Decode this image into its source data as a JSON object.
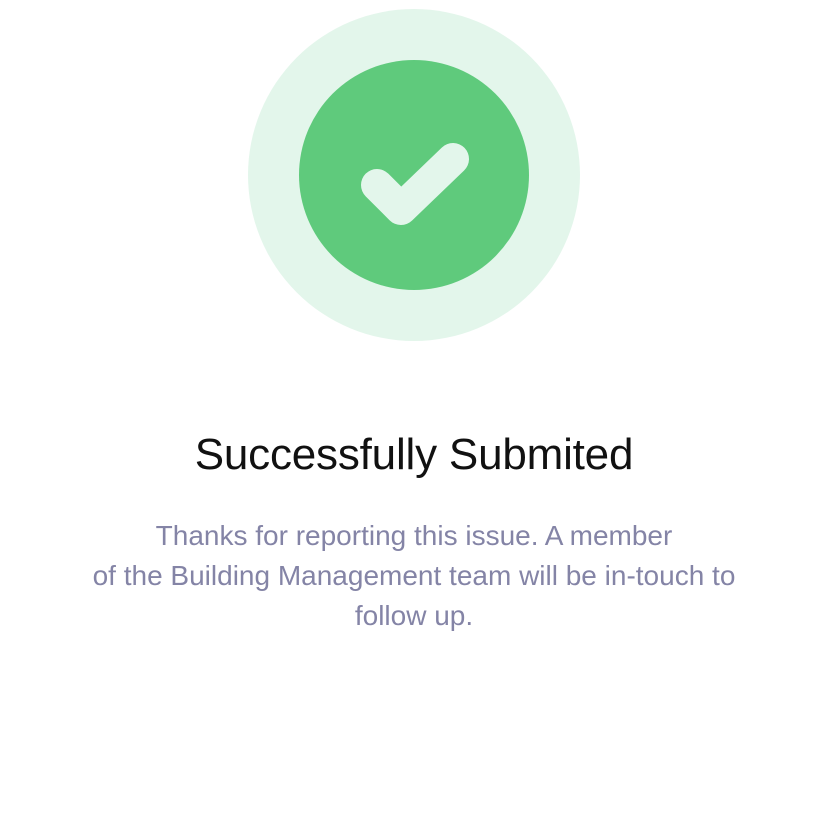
{
  "success": {
    "icon": "check-icon",
    "title": "Successfully Submited",
    "message_lines": [
      "Thanks for reporting this issue. A member",
      "of the Building Management team will be in-touch to",
      "follow up."
    ]
  },
  "colors": {
    "outer_circle": "#e3f6eb",
    "inner_circle": "#5fca7c",
    "check_mark": "#e3f6eb",
    "title_text": "#111111",
    "message_text": "#8484a6"
  }
}
